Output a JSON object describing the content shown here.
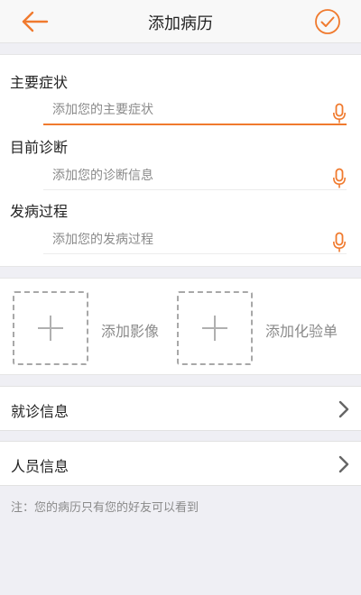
{
  "header": {
    "title": "添加病历",
    "back_icon": "arrow-left-icon",
    "confirm_icon": "check-circle-icon",
    "accent_color": "#f07a2e"
  },
  "record": {
    "fields": [
      {
        "label": "主要症状",
        "placeholder": "添加您的主要症状",
        "icon": "microphone-icon",
        "focused": true
      },
      {
        "label": "目前诊断",
        "placeholder": "添加您的诊断信息",
        "icon": "microphone-icon",
        "focused": false
      },
      {
        "label": "发病过程",
        "placeholder": "添加您的发病过程",
        "icon": "microphone-icon",
        "focused": false
      }
    ]
  },
  "attachments": {
    "image_label": "添加影像",
    "lab_label": "添加化验单",
    "icon": "plus-icon"
  },
  "rows": {
    "visit_info": "就诊信息",
    "person_info": "人员信息",
    "icon": "chevron-right-icon"
  },
  "note": "注：您的病历只有您的好友可以看到"
}
